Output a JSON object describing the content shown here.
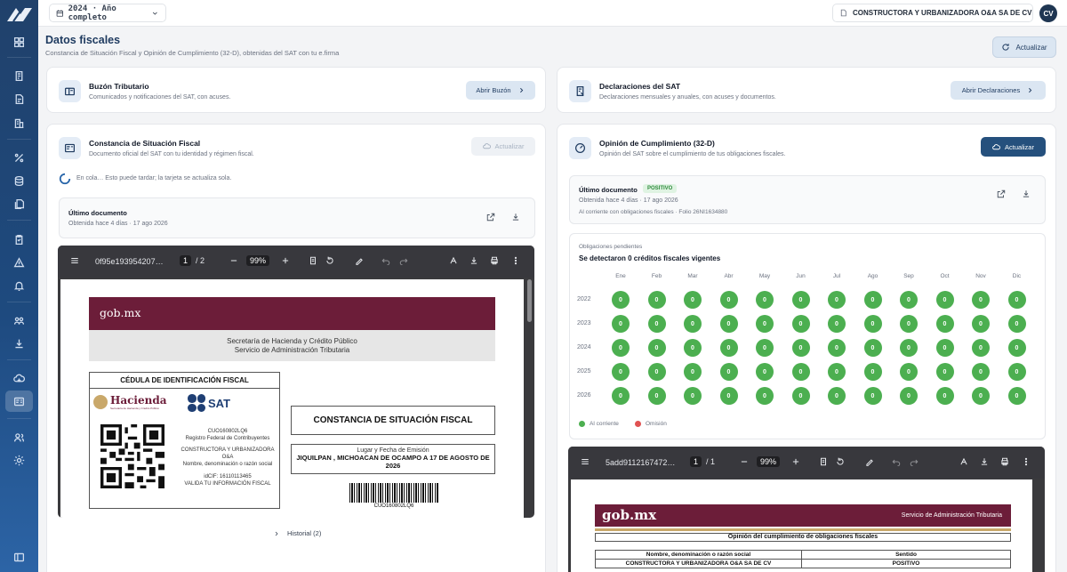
{
  "topbar": {
    "period_label": "2024 · Año completo",
    "company_name": "CONSTRUCTORA Y URBANIZADORA O&A SA DE CV",
    "avatar_initials": "CV"
  },
  "page": {
    "title": "Datos fiscales",
    "subtitle": "Constancia de Situación Fiscal y Opinión de Cumplimiento (32-D), obtenidas del SAT con tu e.firma",
    "refresh_label": "Actualizar"
  },
  "buzon": {
    "title": "Buzón Tributario",
    "desc": "Comunicados y notificaciones del SAT, con acuses.",
    "button": "Abrir Buzón"
  },
  "declaraciones": {
    "title": "Declaraciones del SAT",
    "desc": "Declaraciones mensuales y anuales, con acuses y documentos.",
    "button": "Abrir Declaraciones"
  },
  "csf": {
    "title": "Constancia de Situación Fiscal",
    "desc": "Documento oficial del SAT con tu identidad y régimen fiscal.",
    "button": "Actualizar",
    "queue_text": "En cola… Esto puede tardar; la tarjeta se actualiza sola.",
    "last_doc_label": "Último documento",
    "last_doc_meta": "Obtenida hace 4 días · 17 ago 2026",
    "history": "Historial (2)",
    "pdf": {
      "filename": "0f95e193954207…",
      "page_current": "1",
      "page_total": "/ 2",
      "zoom": "99%",
      "gob": "gob.mx",
      "secretaria": "Secretaría de Hacienda y Crédito Público",
      "servicio": "Servicio de Administración Tributaria",
      "cedula": "CÉDULA DE IDENTIFICACIÓN FISCAL",
      "hacienda": "Hacienda",
      "hacienda_sub": "Secretaría de Hacienda y Crédito Público",
      "sat": "SAT",
      "rfc": "CUO160802LQ6",
      "rfc_label": "Registro Federal de Contribuyentes",
      "razon": "CONSTRUCTORA Y URBANIZADORA O&A",
      "razon_label": "Nombre, denominación o razón social",
      "idcif": "idCIF: 16110113465",
      "valida": "VALIDA TU INFORMACIÓN FISCAL",
      "constancia": "CONSTANCIA DE SITUACIÓN FISCAL",
      "lugar_label": "Lugar y Fecha de Emisión",
      "lugar": "JIQUILPAN , MICHOACAN DE OCAMPO A 17 DE AGOSTO DE 2026",
      "barcode_text": "CUO160802LQ6"
    }
  },
  "opinion": {
    "title": "Opinión de Cumplimiento (32-D)",
    "desc": "Opinión del SAT sobre el cumplimiento de tus obligaciones fiscales.",
    "button": "Actualizar",
    "last_doc_label": "Último documento",
    "badge": "POSITIVO",
    "last_doc_meta": "Obtenida hace 4 días · 17 ago 2026",
    "last_doc_folio": "Al corriente con obligaciones fiscales · Folio 26NI1634880",
    "pending_label": "Obligaciones pendientes",
    "pending_title": "Se detectaron 0 créditos fiscales vigentes",
    "months": [
      "Ene",
      "Feb",
      "Mar",
      "Abr",
      "May",
      "Jun",
      "Jul",
      "Ago",
      "Sep",
      "Oct",
      "Nov",
      "Dic"
    ],
    "years": [
      "2022",
      "2023",
      "2024",
      "2025",
      "2026"
    ],
    "matrix_value": "0",
    "legend_ok": "Al corriente",
    "legend_bad": "Omisión",
    "color_ok": "#4caf50",
    "color_bad": "#e05252",
    "pdf": {
      "filename": "5add9112167472…",
      "page_current": "1",
      "page_total": "/ 1",
      "zoom": "99%",
      "gob": "gob.mx",
      "servicio": "Servicio de Administración Tributaria",
      "opinion_title": "Opinión del cumplimiento de obligaciones fiscales",
      "col1": "Nombre, denominación o razón social",
      "col2": "Sentido",
      "val1": "CONSTRUCTORA Y URBANIZADORA O&A SA DE CV",
      "val2": "POSITIVO"
    }
  }
}
